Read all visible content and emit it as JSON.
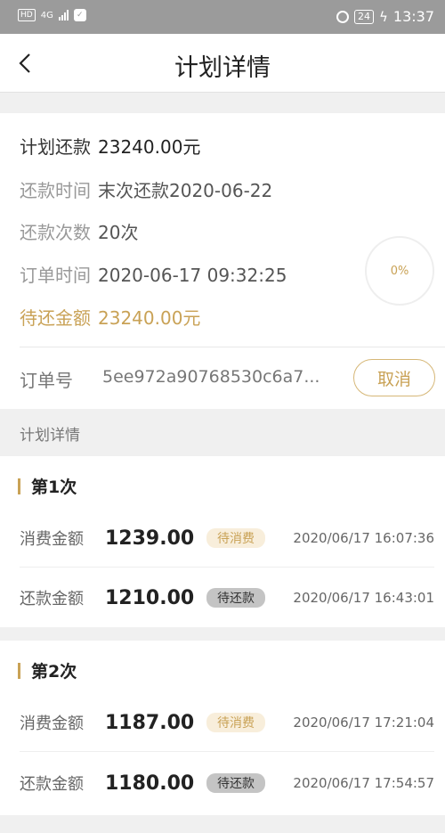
{
  "status_bar": {
    "network_badge": "HD",
    "network_type": "4G",
    "battery": "24",
    "time": "13:37"
  },
  "nav": {
    "title": "计划详情"
  },
  "summary": {
    "plan_repay_label": "计划还款",
    "plan_repay_value": "23240.00元",
    "repay_time_label": "还款时间",
    "repay_time_value": "末次还款2020-06-22",
    "repay_count_label": "还款次数",
    "repay_count_value": "20次",
    "order_time_label": "订单时间",
    "order_time_value": "2020-06-17 09:32:25",
    "pending_label": "待还金额",
    "pending_value": "23240.00元",
    "progress_text": "0%",
    "progress_value": 0
  },
  "order": {
    "label": "订单号",
    "number": "5ee972a90768530c6a7...",
    "cancel_label": "取消"
  },
  "section_title": "计划详情",
  "plans": [
    {
      "title": "第1次",
      "items": [
        {
          "label": "消费金额",
          "amount": "1239.00",
          "status": "待消费",
          "time": "2020/06/17 16:07:36"
        },
        {
          "label": "还款金额",
          "amount": "1210.00",
          "status": "待还款",
          "time": "2020/06/17 16:43:01"
        }
      ]
    },
    {
      "title": "第2次",
      "items": [
        {
          "label": "消费金额",
          "amount": "1187.00",
          "status": "待消费",
          "time": "2020/06/17 17:21:04"
        },
        {
          "label": "还款金额",
          "amount": "1180.00",
          "status": "待还款",
          "time": "2020/06/17 17:54:57"
        }
      ]
    }
  ],
  "colors": {
    "accent_gold": "#c9a256",
    "badge_consume_bg": "#f8eedb",
    "badge_repay_bg": "#c4c4c4",
    "status_bar_bg": "#9b9b9b"
  }
}
